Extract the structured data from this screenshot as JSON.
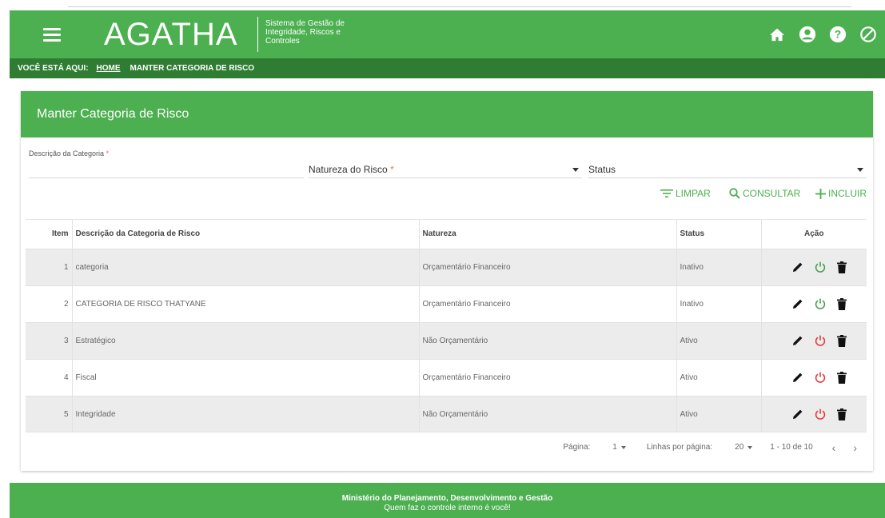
{
  "app": {
    "logo": "AGATHA",
    "subtitle": "Sistema de Gestão de Integridade, Riscos e Controles"
  },
  "header_icons": [
    "home-icon",
    "account-icon",
    "help-icon",
    "block-icon"
  ],
  "breadcrumb": {
    "here_label": "VOCÊ ESTÁ AQUI:",
    "home": "HOME",
    "current": "MANTER CATEGORIA DE RISCO"
  },
  "card": {
    "title": "Manter Categoria de Risco"
  },
  "filters": {
    "descricao_label": "Descrição da Categoria",
    "descricao_value": "",
    "natureza_label": "Natureza do Risco",
    "status_label": "Status",
    "required_mark": "*"
  },
  "actions": {
    "limpar": "LIMPAR",
    "consultar": "CONSULTAR",
    "incluir": "INCLUIR"
  },
  "table": {
    "headers": {
      "item": "Item",
      "descricao": "Descrição da Categoria de Risco",
      "natureza": "Natureza",
      "status": "Status",
      "acao": "Ação"
    },
    "rows": [
      {
        "item": "1",
        "descricao": "categoria",
        "natureza": "Orçamentário Financeiro",
        "status": "Inativo",
        "active": false
      },
      {
        "item": "2",
        "descricao": "CATEGORIA DE RISCO THATYANE",
        "natureza": "Orçamentário Financeiro",
        "status": "Inativo",
        "active": false
      },
      {
        "item": "3",
        "descricao": "Estratégico",
        "natureza": "Não Orçamentário",
        "status": "Ativo",
        "active": true
      },
      {
        "item": "4",
        "descricao": "Fiscal",
        "natureza": "Orçamentário Financeiro",
        "status": "Ativo",
        "active": true
      },
      {
        "item": "5",
        "descricao": "Integridade",
        "natureza": "Não Orçamentário",
        "status": "Ativo",
        "active": true
      }
    ]
  },
  "pager": {
    "page_label": "Página:",
    "page_value": "1",
    "rows_label": "Linhas por página:",
    "rows_value": "20",
    "range": "1 - 10 de 10"
  },
  "footer": {
    "line1": "Ministério do Planejamento, Desenvolvimento e Gestão",
    "line2": "Quem faz o controle interno é você!"
  },
  "colors": {
    "primary": "#4caf50",
    "primary_dark": "#2e7d32",
    "power_active": "#e53935",
    "power_inactive": "#43a047"
  }
}
